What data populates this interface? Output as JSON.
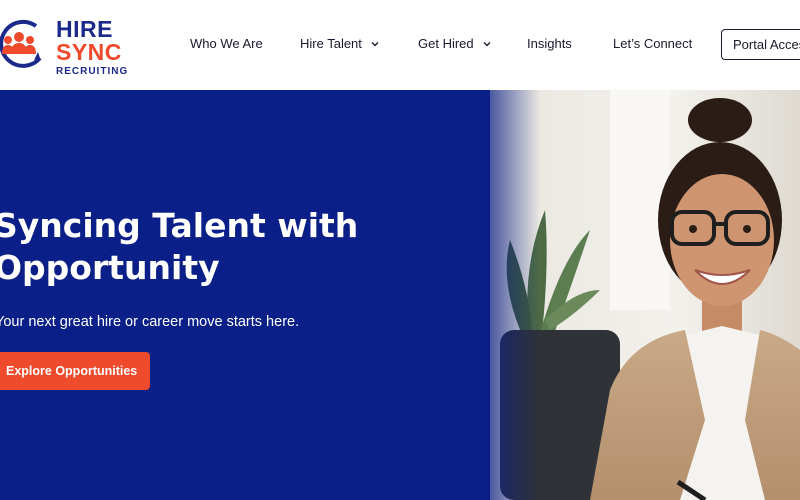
{
  "brand": {
    "line1": "HIRE",
    "line2": "SYNC",
    "line3": "RECRUITING",
    "navy": "#1b2a8a",
    "orange": "#ee4a2b"
  },
  "nav": {
    "items": [
      {
        "label": "Who We Are",
        "has_dropdown": false
      },
      {
        "label": "Hire Talent",
        "has_dropdown": true
      },
      {
        "label": "Get Hired",
        "has_dropdown": true
      },
      {
        "label": "Insights",
        "has_dropdown": false
      },
      {
        "label": "Let’s Connect",
        "has_dropdown": false
      }
    ],
    "portal_label": "Portal Access"
  },
  "hero": {
    "title": "Syncing Talent with Opportunity",
    "subtitle": "Your next great hire or career move starts here.",
    "cta_label": "Explore Opportunities",
    "background": "#0a1f87",
    "photo_icon": "smiling-professional-woman-photo"
  }
}
